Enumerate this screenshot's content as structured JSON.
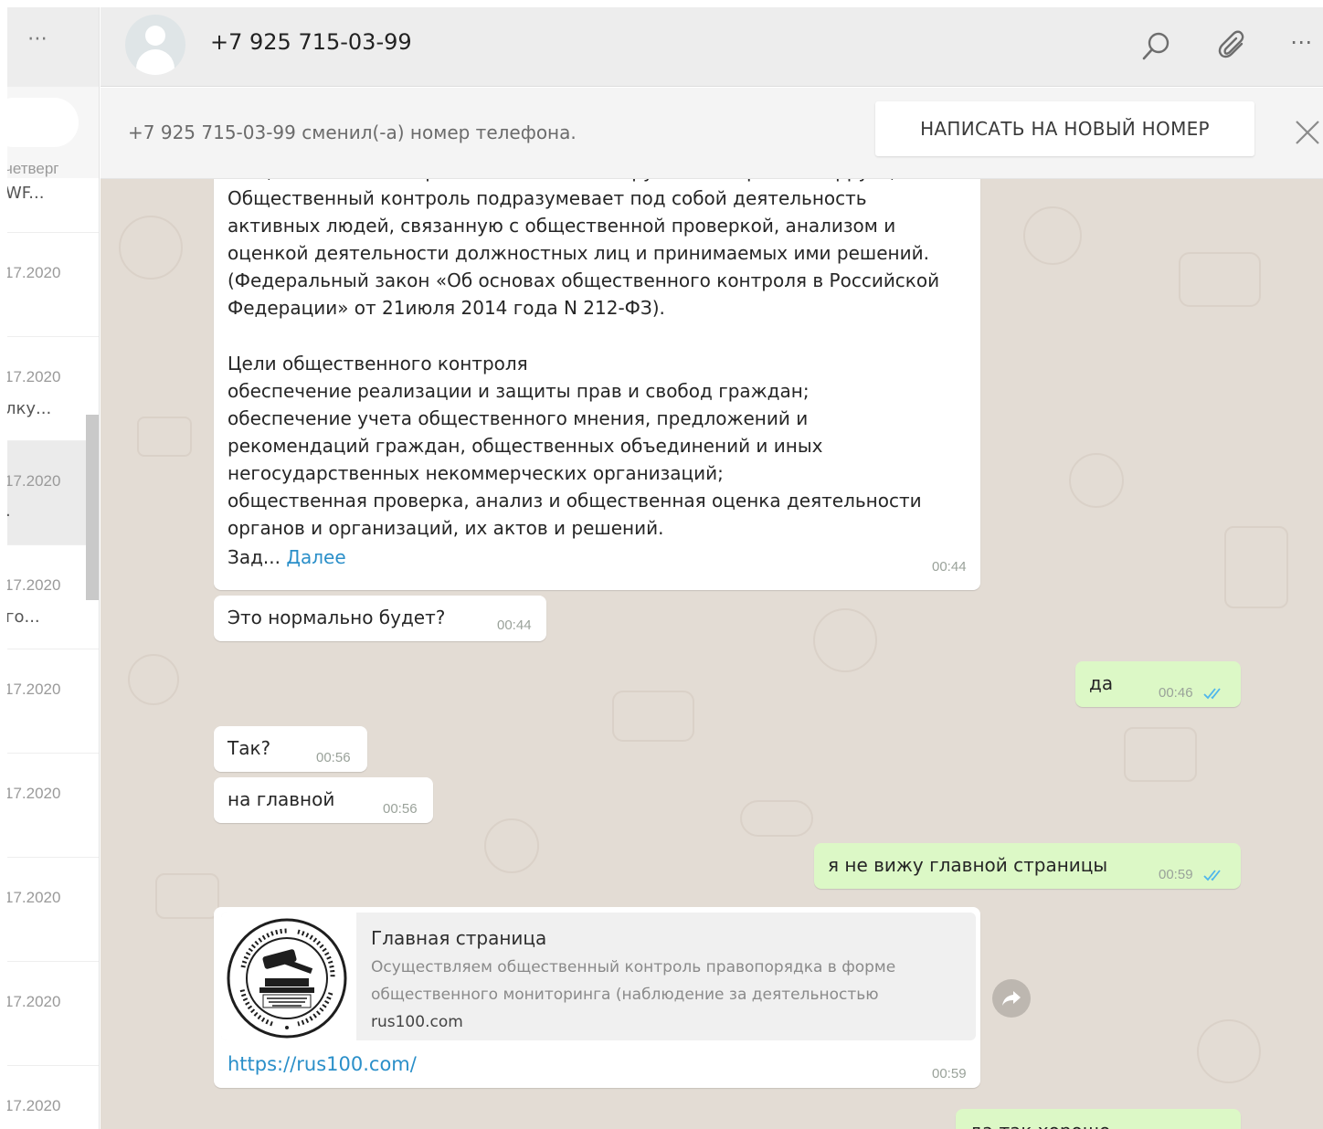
{
  "sidebar": {
    "menu_glyph": "⋯",
    "top_partial": {
      "date": "четверг",
      "snippet": "WF..."
    },
    "items": [
      {
        "date": "17.2020",
        "snippet": ""
      },
      {
        "date": "17.2020",
        "snippet": "лку..."
      },
      {
        "date": "17.2020",
        "snippet": "."
      },
      {
        "date": "17.2020",
        "snippet": "го..."
      },
      {
        "date": "17.2020",
        "snippet": ""
      },
      {
        "date": "17.2020",
        "snippet": ""
      },
      {
        "date": "17.2020",
        "snippet": ""
      },
      {
        "date": "17.2020",
        "snippet": ""
      },
      {
        "date": "17.2020",
        "snippet": ""
      }
    ]
  },
  "header": {
    "contact_name": "+7 925 715-03-99",
    "icons": [
      "search-icon",
      "attach-icon",
      "menu-icon"
    ],
    "menu_glyph": "⋯"
  },
  "banner": {
    "text": "+7 925 715-03-99 сменил(-а) номер телефона.",
    "button_label": "НАПИСАТЬ НА НОВЫЙ НОМЕР"
  },
  "messages": {
    "long_message": {
      "text": "Общественный контроль – основной инструмент в борьбе с коррупцией!\nОбщественный контроль подразумевает под собой деятельность\nактивных людей, связанную с общественной проверкой, анализом и\nоценкой деятельности должностных лиц и принимаемых ими решений.\n(Федеральный закон «Об основах общественного контроля в Российской\nФедерации» от 21июля 2014 года N 212-ФЗ).\n\nЦели общественного контроля\nобеспечение реализации и защиты прав и свобод граждан;\nобеспечение учета общественного мнения, предложений и\nрекомендаций граждан, общественных объединений и иных\nнегосударственных некоммерческих организаций;\nобщественная проверка, анализ и общественная оценка деятельности\nорганов и организаций, их актов и решений.",
      "tail": "Зад...",
      "more": "Далее",
      "time": "00:44"
    },
    "m1": {
      "text": "Это нормально будет?",
      "time": "00:44"
    },
    "m2": {
      "text": "да",
      "time": "00:46"
    },
    "m3": {
      "text": "Так?",
      "time": "00:56"
    },
    "m4": {
      "text": "на главной",
      "time": "00:56"
    },
    "m5": {
      "text": "я не вижу главной страницы",
      "time": "00:59"
    },
    "link_message": {
      "preview_title": "Главная страница",
      "preview_desc_1": "Осуществляем общественный контроль правопорядка в форме",
      "preview_desc_2": "общественного мониторинга (наблюдение за деятельностью",
      "preview_host": "rus100.com",
      "url": "https://rus100.com/",
      "time": "00:59",
      "logo_text": "ОБЩЕСТВЕННЫЙ КОНТРОЛЬ ПРАВОПОРЯДКА",
      "logo_inner": [
        "МЕЖДУНАРОДНОЕ",
        "ОБЩЕСТВЕННОЕ",
        "ДВИЖЕНИЕ"
      ]
    },
    "m6_partial": {
      "text": "да так хорошо"
    }
  },
  "colors": {
    "chat_background": "#e3dcd4",
    "outgoing_bubble": "#dcf8c6",
    "incoming_bubble": "#ffffff",
    "link": "#2a8fc9",
    "read_ticks": "#4fb6ec"
  }
}
